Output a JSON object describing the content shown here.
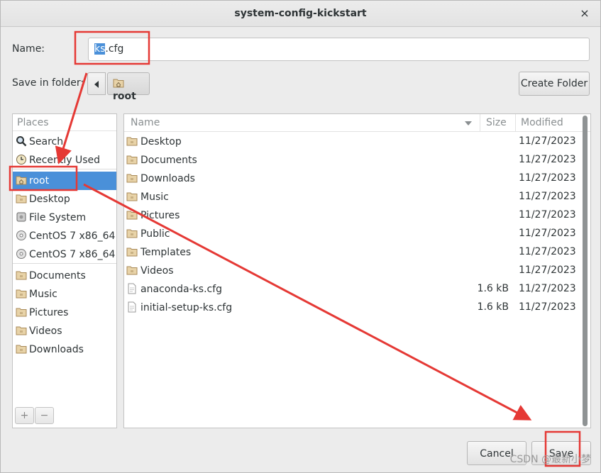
{
  "window": {
    "title": "system-config-kickstart",
    "close_glyph": "×"
  },
  "name_field": {
    "label": "Name:",
    "value_selected": "ks",
    "value_rest": ".cfg"
  },
  "folder": {
    "label": "Save in folder:",
    "current": "root"
  },
  "create_folder_label": "Create Folder",
  "places": {
    "header": "Places",
    "items": [
      {
        "label": "Search",
        "icon": "search-icon"
      },
      {
        "label": "Recently Used",
        "icon": "clock-icon"
      },
      {
        "label": "root",
        "icon": "home-folder-icon",
        "selected": true
      },
      {
        "label": "Desktop",
        "icon": "folder-icon"
      },
      {
        "label": "File System",
        "icon": "drive-icon"
      },
      {
        "label": "CentOS 7 x86_64",
        "icon": "disc-icon"
      },
      {
        "label": "CentOS 7 x86_64",
        "icon": "disc-icon"
      },
      {
        "label": "Documents",
        "icon": "folder-icon"
      },
      {
        "label": "Music",
        "icon": "folder-icon"
      },
      {
        "label": "Pictures",
        "icon": "folder-icon"
      },
      {
        "label": "Videos",
        "icon": "folder-icon"
      },
      {
        "label": "Downloads",
        "icon": "folder-icon"
      }
    ],
    "add_glyph": "+",
    "remove_glyph": "−"
  },
  "files": {
    "columns": {
      "name": "Name",
      "size": "Size",
      "modified": "Modified"
    },
    "rows": [
      {
        "name": "Desktop",
        "size": "",
        "modified": "11/27/2023",
        "kind": "folder"
      },
      {
        "name": "Documents",
        "size": "",
        "modified": "11/27/2023",
        "kind": "folder"
      },
      {
        "name": "Downloads",
        "size": "",
        "modified": "11/27/2023",
        "kind": "folder"
      },
      {
        "name": "Music",
        "size": "",
        "modified": "11/27/2023",
        "kind": "folder"
      },
      {
        "name": "Pictures",
        "size": "",
        "modified": "11/27/2023",
        "kind": "folder"
      },
      {
        "name": "Public",
        "size": "",
        "modified": "11/27/2023",
        "kind": "folder"
      },
      {
        "name": "Templates",
        "size": "",
        "modified": "11/27/2023",
        "kind": "folder"
      },
      {
        "name": "Videos",
        "size": "",
        "modified": "11/27/2023",
        "kind": "folder"
      },
      {
        "name": "anaconda-ks.cfg",
        "size": "1.6 kB",
        "modified": "11/27/2023",
        "kind": "file"
      },
      {
        "name": "initial-setup-ks.cfg",
        "size": "1.6 kB",
        "modified": "11/27/2023",
        "kind": "file"
      }
    ]
  },
  "buttons": {
    "cancel": "Cancel",
    "save": "Save"
  },
  "watermark": "CSDN @最新小梦",
  "colors": {
    "selection": "#4a90d9",
    "annotation": "#e53935"
  }
}
